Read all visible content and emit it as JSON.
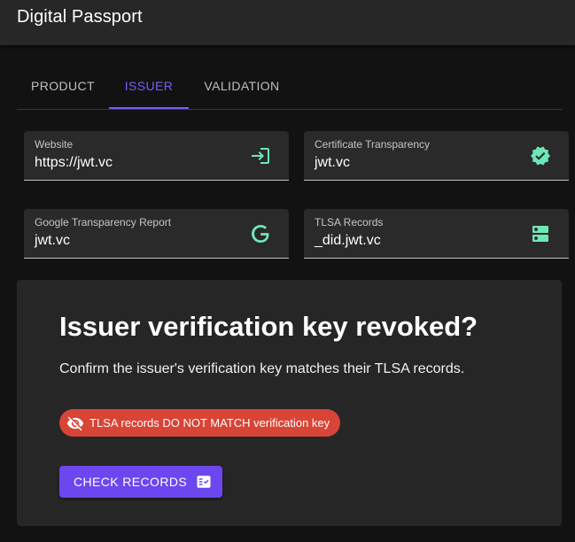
{
  "appbar": {
    "title": "Digital Passport"
  },
  "tabs": [
    {
      "label": "PRODUCT",
      "active": false
    },
    {
      "label": "ISSUER",
      "active": true
    },
    {
      "label": "VALIDATION",
      "active": false
    }
  ],
  "fields": [
    {
      "label": "Website",
      "value": "https://jwt.vc",
      "icon": "login-icon"
    },
    {
      "label": "Certificate Transparency",
      "value": "jwt.vc",
      "icon": "verified-badge-icon"
    },
    {
      "label": "Google Transparency Report",
      "value": "jwt.vc",
      "icon": "google-icon"
    },
    {
      "label": "TLSA Records",
      "value": "_did.jwt.vc",
      "icon": "dns-server-icon"
    }
  ],
  "card": {
    "title": "Issuer verification key revoked?",
    "description": "Confirm the issuer's verification key matches their TLSA records.",
    "status_chip": {
      "label": "TLSA records DO NOT MATCH verification key",
      "icon": "visibility-off-icon"
    },
    "button": {
      "label": "CHECK RECORDS",
      "icon": "fact-check-icon"
    }
  },
  "colors": {
    "background": "#121212",
    "appbar": "#272727",
    "accent": "#7c5cf5",
    "button": "#6c47f0",
    "field_icon": "#6ee7b7",
    "error_chip": "#d84436",
    "card": "#262626",
    "field": "#2a2a2a"
  }
}
